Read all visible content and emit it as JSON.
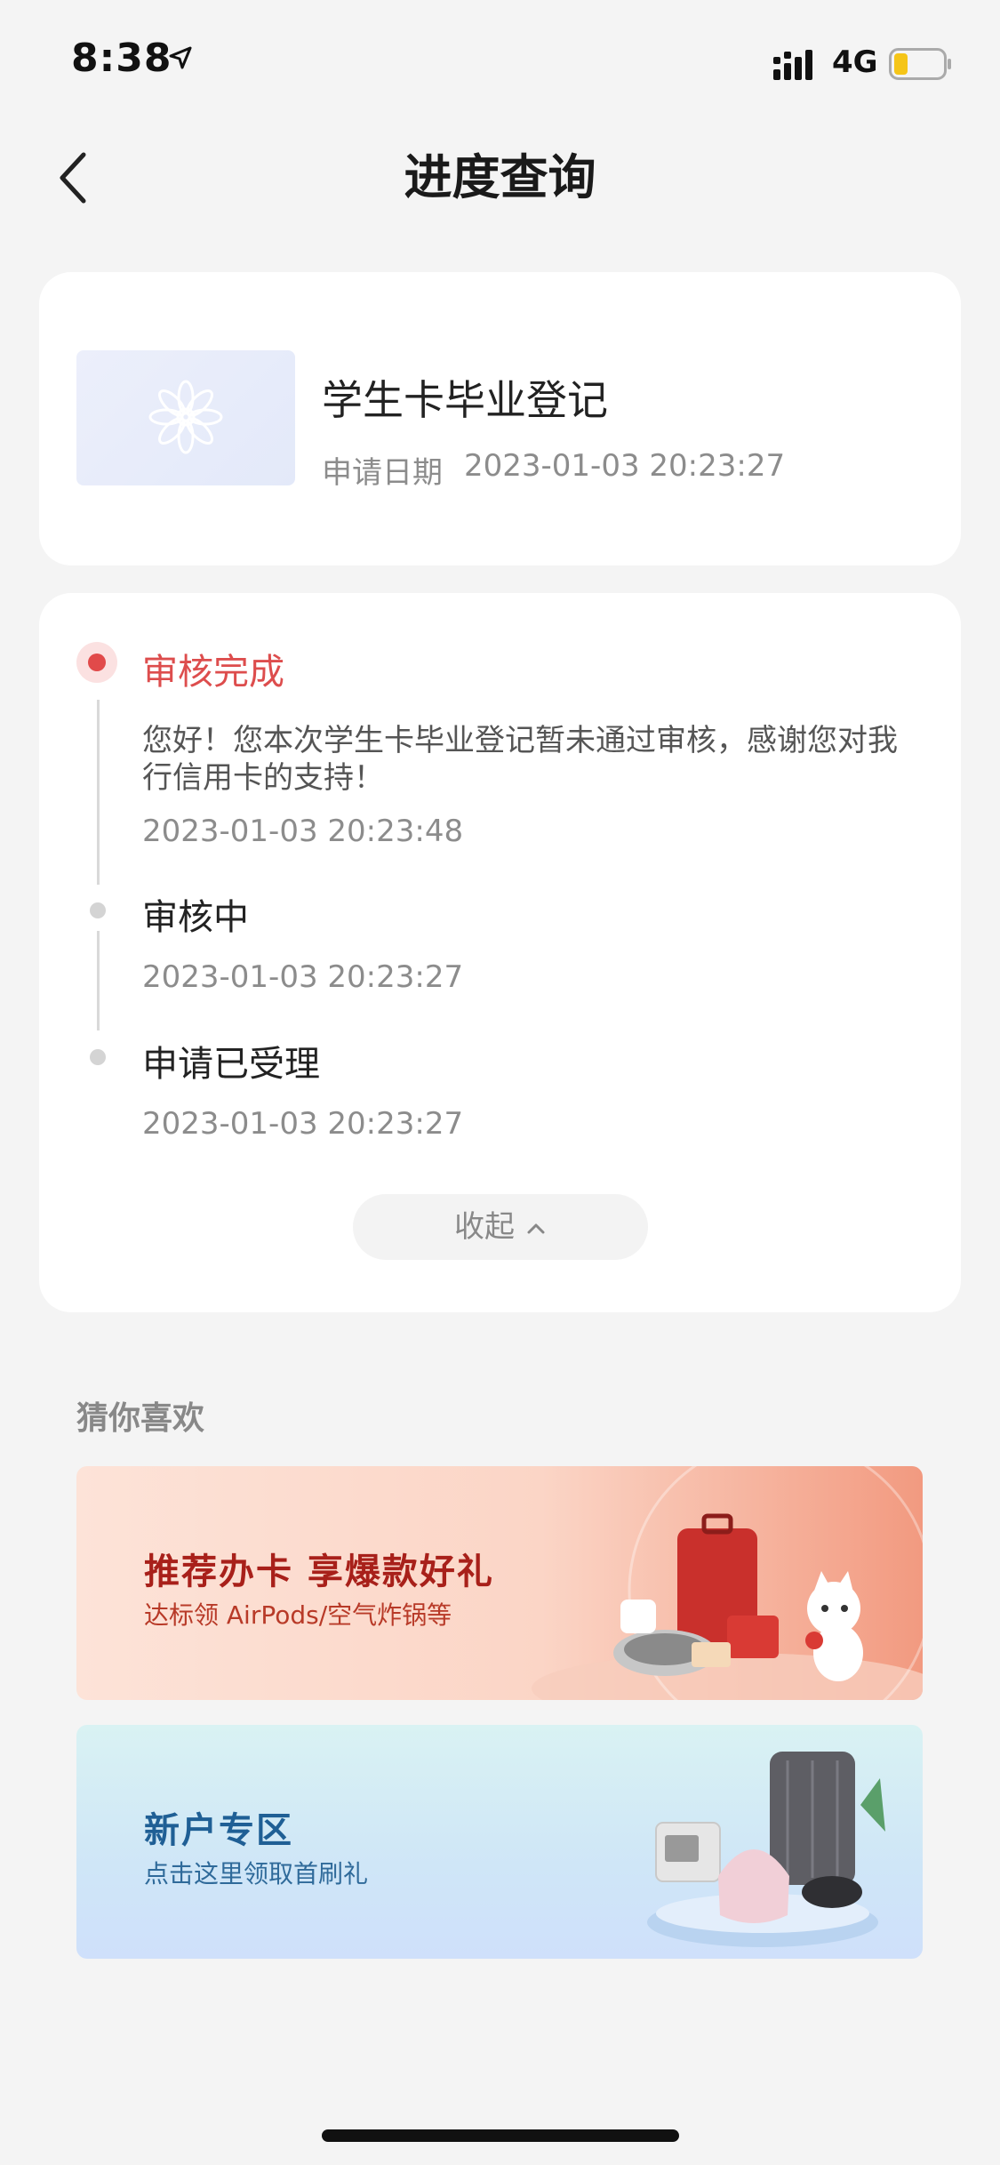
{
  "status_bar": {
    "time": "8:38",
    "network": "4G"
  },
  "nav": {
    "title": "进度查询"
  },
  "application": {
    "name": "学生卡毕业登记",
    "date_label": "申请日期",
    "date": "2023-01-03 20:23:27"
  },
  "progress": {
    "steps": [
      {
        "title": "审核完成",
        "message": "您好！您本次学生卡毕业登记暂未通过审核，感谢您对我行信用卡的支持！",
        "time": "2023-01-03 20:23:48"
      },
      {
        "title": "审核中",
        "time": "2023-01-03 20:23:27"
      },
      {
        "title": "申请已受理",
        "time": "2023-01-03 20:23:27"
      }
    ],
    "collapse_label": "收起"
  },
  "recommend": {
    "title": "猜你喜欢",
    "banners": [
      {
        "title": "推荐办卡 享爆款好礼",
        "subtitle": "达标领 AirPods/空气炸锅等"
      },
      {
        "title": "新户专区",
        "subtitle": "点击这里领取首刷礼"
      }
    ]
  },
  "colors": {
    "accent": "#dd4d4d",
    "background": "#f4f4f4"
  },
  "icons": [
    "location-arrow-icon",
    "signal-icon",
    "battery-icon",
    "back-chevron-icon",
    "flower-icon",
    "chevron-up-icon"
  ]
}
